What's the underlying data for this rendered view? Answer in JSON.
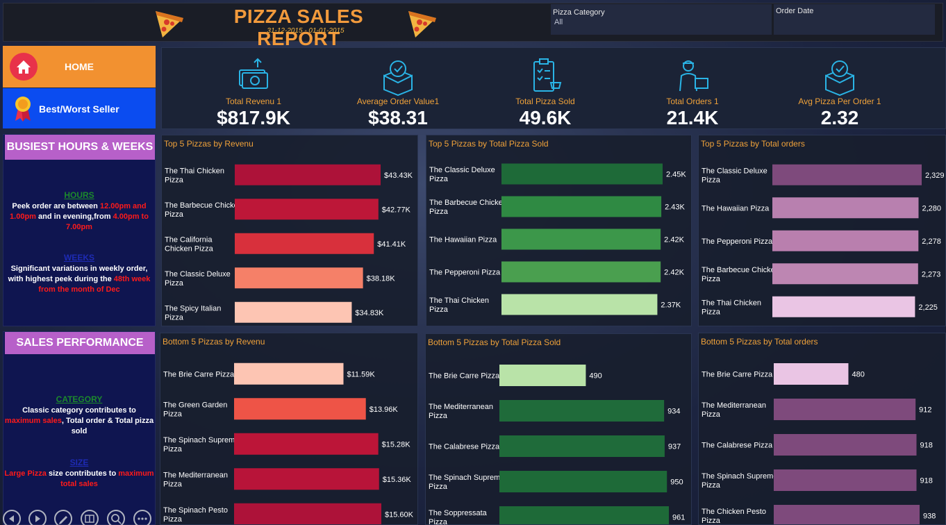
{
  "header": {
    "title": "PIZZA SALES REPORT",
    "date_range": "31-12-2015 - 01-01-2015",
    "filters": [
      {
        "label": "Pizza Category",
        "value": "All"
      },
      {
        "label": "Order Date",
        "value": ""
      }
    ]
  },
  "nav": {
    "home_label": "HOME",
    "best_worst_label": "Best/Worst Seller"
  },
  "insights": {
    "busiest": {
      "heading": "BUSIEST HOURS & WEEKS",
      "hours_title": "HOURS",
      "hours_t1": "Peek order are between ",
      "hours_h1": "12.00pm and 1.00pm",
      "hours_t2": " and in evening,from ",
      "hours_h2": "4.00pm to 7.00pm",
      "weeks_title": "WEEKS",
      "weeks_t1": "Significant variations in weekly order, with highest peek during the ",
      "weeks_h1": "48th week from the month of Dec"
    },
    "sales": {
      "heading": "SALES PERFORMANCE",
      "category_title": "CATEGORY",
      "cat_t1": "Classic category contributes to ",
      "cat_h1": "maximum sales",
      "cat_t2": ", Total order & Total pizza sold",
      "size_title": "SIZE",
      "size_h1": "Large Pizza",
      "size_t1": " size contributes to ",
      "size_h2": "maximum total sales"
    }
  },
  "kpis": [
    {
      "label": "Total Revenu 1",
      "value": "$817.9K",
      "icon": "money-transfer-icon"
    },
    {
      "label": "Average Order Value1",
      "value": "$38.31",
      "icon": "order-box-icon"
    },
    {
      "label": "Total Pizza Sold",
      "value": "49.6K",
      "icon": "clipboard-cart-icon"
    },
    {
      "label": "Total Orders 1",
      "value": "21.4K",
      "icon": "delivery-person-icon"
    },
    {
      "label": "Avg Pizza Per Order 1",
      "value": "2.32",
      "icon": "checked-box-icon"
    }
  ],
  "colors": {
    "accent_orange": "#f29a3c",
    "home_orange": "#f29130",
    "nav_blue": "#0b4cf0",
    "insight_purple": "#b760c9"
  },
  "chart_data": [
    {
      "type": "bar",
      "orientation": "horizontal",
      "title": "Top 5 Pizzas by Revenu",
      "categories": [
        "The Thai Chicken Pizza",
        "The Barbecue Chicken Pizza",
        "The California Chicken Pizza",
        "The Classic Deluxe Pizza",
        "The Spicy Italian Pizza"
      ],
      "values": [
        43.43,
        42.77,
        41.41,
        38.18,
        34.83
      ],
      "labels": [
        "$43.43K",
        "$42.77K",
        "$41.41K",
        "$38.18K",
        "$34.83K"
      ],
      "colors": [
        "#ad1239",
        "#bd1738",
        "#d8303c",
        "#f58068",
        "#fdc5b3"
      ]
    },
    {
      "type": "bar",
      "orientation": "horizontal",
      "title": "Top 5 Pizzas by Total Pizza Sold",
      "categories": [
        "The Classic Deluxe Pizza",
        "The Barbecue Chicken Pizza",
        "The Hawaiian Pizza",
        "The Pepperoni Pizza",
        "The Thai Chicken Pizza"
      ],
      "values": [
        2.45,
        2.43,
        2.42,
        2.42,
        2.37
      ],
      "labels": [
        "2.45K",
        "2.43K",
        "2.42K",
        "2.42K",
        "2.37K"
      ],
      "colors": [
        "#1e6a38",
        "#2f8a43",
        "#3c974a",
        "#4a9f4f",
        "#b9e3a8"
      ]
    },
    {
      "type": "bar",
      "orientation": "horizontal",
      "title": "Top 5 Pizzas by Total orders",
      "categories": [
        "The Classic Deluxe Pizza",
        "The Hawaiian Pizza",
        "The Pepperoni Pizza",
        "The Barbecue Chicken Pizza",
        "The Thai Chicken Pizza"
      ],
      "values": [
        2329,
        2280,
        2278,
        2273,
        2225
      ],
      "labels": [
        "2,329",
        "2,280",
        "2,278",
        "2,273",
        "2,225"
      ],
      "colors": [
        "#7e4a7c",
        "#b880af",
        "#b97fae",
        "#bd86b2",
        "#eac5e4"
      ]
    },
    {
      "type": "bar",
      "orientation": "horizontal",
      "title": "Bottom 5 Pizzas by Revenu",
      "categories": [
        "The Brie Carre Pizza",
        "The Green Garden Pizza",
        "The Spinach Supreme Pizza",
        "The Mediterranean Pizza",
        "The Spinach Pesto Pizza"
      ],
      "values": [
        11.59,
        13.96,
        15.28,
        15.36,
        15.6
      ],
      "labels": [
        "$11.59K",
        "$13.96K",
        "$15.28K",
        "$15.36K",
        "$15.60K"
      ],
      "colors": [
        "#fdc5b3",
        "#ee5447",
        "#bc1538",
        "#b81439",
        "#ad1239"
      ]
    },
    {
      "type": "bar",
      "orientation": "horizontal",
      "title": "Bottom 5 Pizzas by Total Pizza Sold",
      "categories": [
        "The Brie Carre Pizza",
        "The Mediterranean Pizza",
        "The Calabrese Pizza",
        "The Spinach Supreme Pizza",
        "The Soppressata Pizza"
      ],
      "values": [
        490,
        934,
        937,
        950,
        961
      ],
      "labels": [
        "490",
        "934",
        "937",
        "950",
        "961"
      ],
      "colors": [
        "#b9e3a8",
        "#1f6b3a",
        "#1f6b3a",
        "#1e6a38",
        "#1e6a38"
      ]
    },
    {
      "type": "bar",
      "orientation": "horizontal",
      "title": "Bottom 5 Pizzas by Total orders",
      "categories": [
        "The Brie Carre Pizza",
        "The Mediterranean Pizza",
        "The Calabrese Pizza",
        "The Spinach Supreme Pizza",
        "The Chicken Pesto Pizza"
      ],
      "values": [
        480,
        912,
        918,
        918,
        938
      ],
      "labels": [
        "480",
        "912",
        "918",
        "918",
        "938"
      ],
      "colors": [
        "#eac5e4",
        "#7e4a7c",
        "#7e4a7c",
        "#7e4a7c",
        "#7e4a7c"
      ]
    }
  ]
}
